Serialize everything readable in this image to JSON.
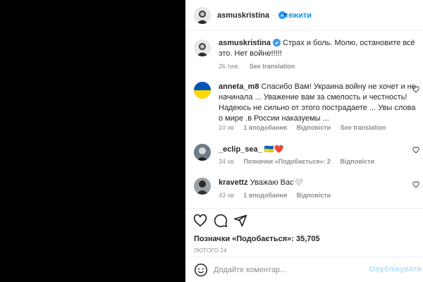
{
  "post": {
    "author": "asmuskristina",
    "follow_label": "Стежити",
    "dot": "•"
  },
  "caption": {
    "author": "asmuskristina",
    "text": "Страх и боль. Молю, остановите всё это. Нет войне!!!!!",
    "time": "26 тиж.",
    "see_translation": "See translation"
  },
  "comments": [
    {
      "author": "anneta_m8",
      "text": "Спасибо Вам! Украина войну не хочет и не начинала ... Уважение вам за смелость и честность! Надеюсь не сильно от этого пострадаете ... Увы слова о мире .в России наказуемы ...",
      "time": "10 хв",
      "likes": "1 вподобання",
      "reply": "Відповісти",
      "see_translation": "See translation"
    },
    {
      "author": "_eclip_sea_",
      "text": "🇺🇦❤️",
      "time": "34 хв",
      "likes": "Позначки «Подобається»: 2",
      "reply": "Відповісти"
    },
    {
      "author": "kravettz",
      "text": "Уважаю Вас🤍",
      "time": "43 хв",
      "likes": "1 вподобання",
      "reply": "Відповісти"
    }
  ],
  "actions": {
    "like_icon": "heart-outline-icon",
    "comment_icon": "comment-bubble-icon",
    "share_icon": "paper-plane-icon"
  },
  "likes_text": "Позначки «Подобається»: 35,705",
  "date": "ЛЮТОГО 24",
  "add_comment": {
    "placeholder": "Додайте коментар...",
    "publish": "Опублікувати"
  },
  "colors": {
    "accent": "#0095f6",
    "verified": "#3897f0",
    "muted": "#8e8e8e",
    "publish_disabled": "#b2dffc"
  }
}
